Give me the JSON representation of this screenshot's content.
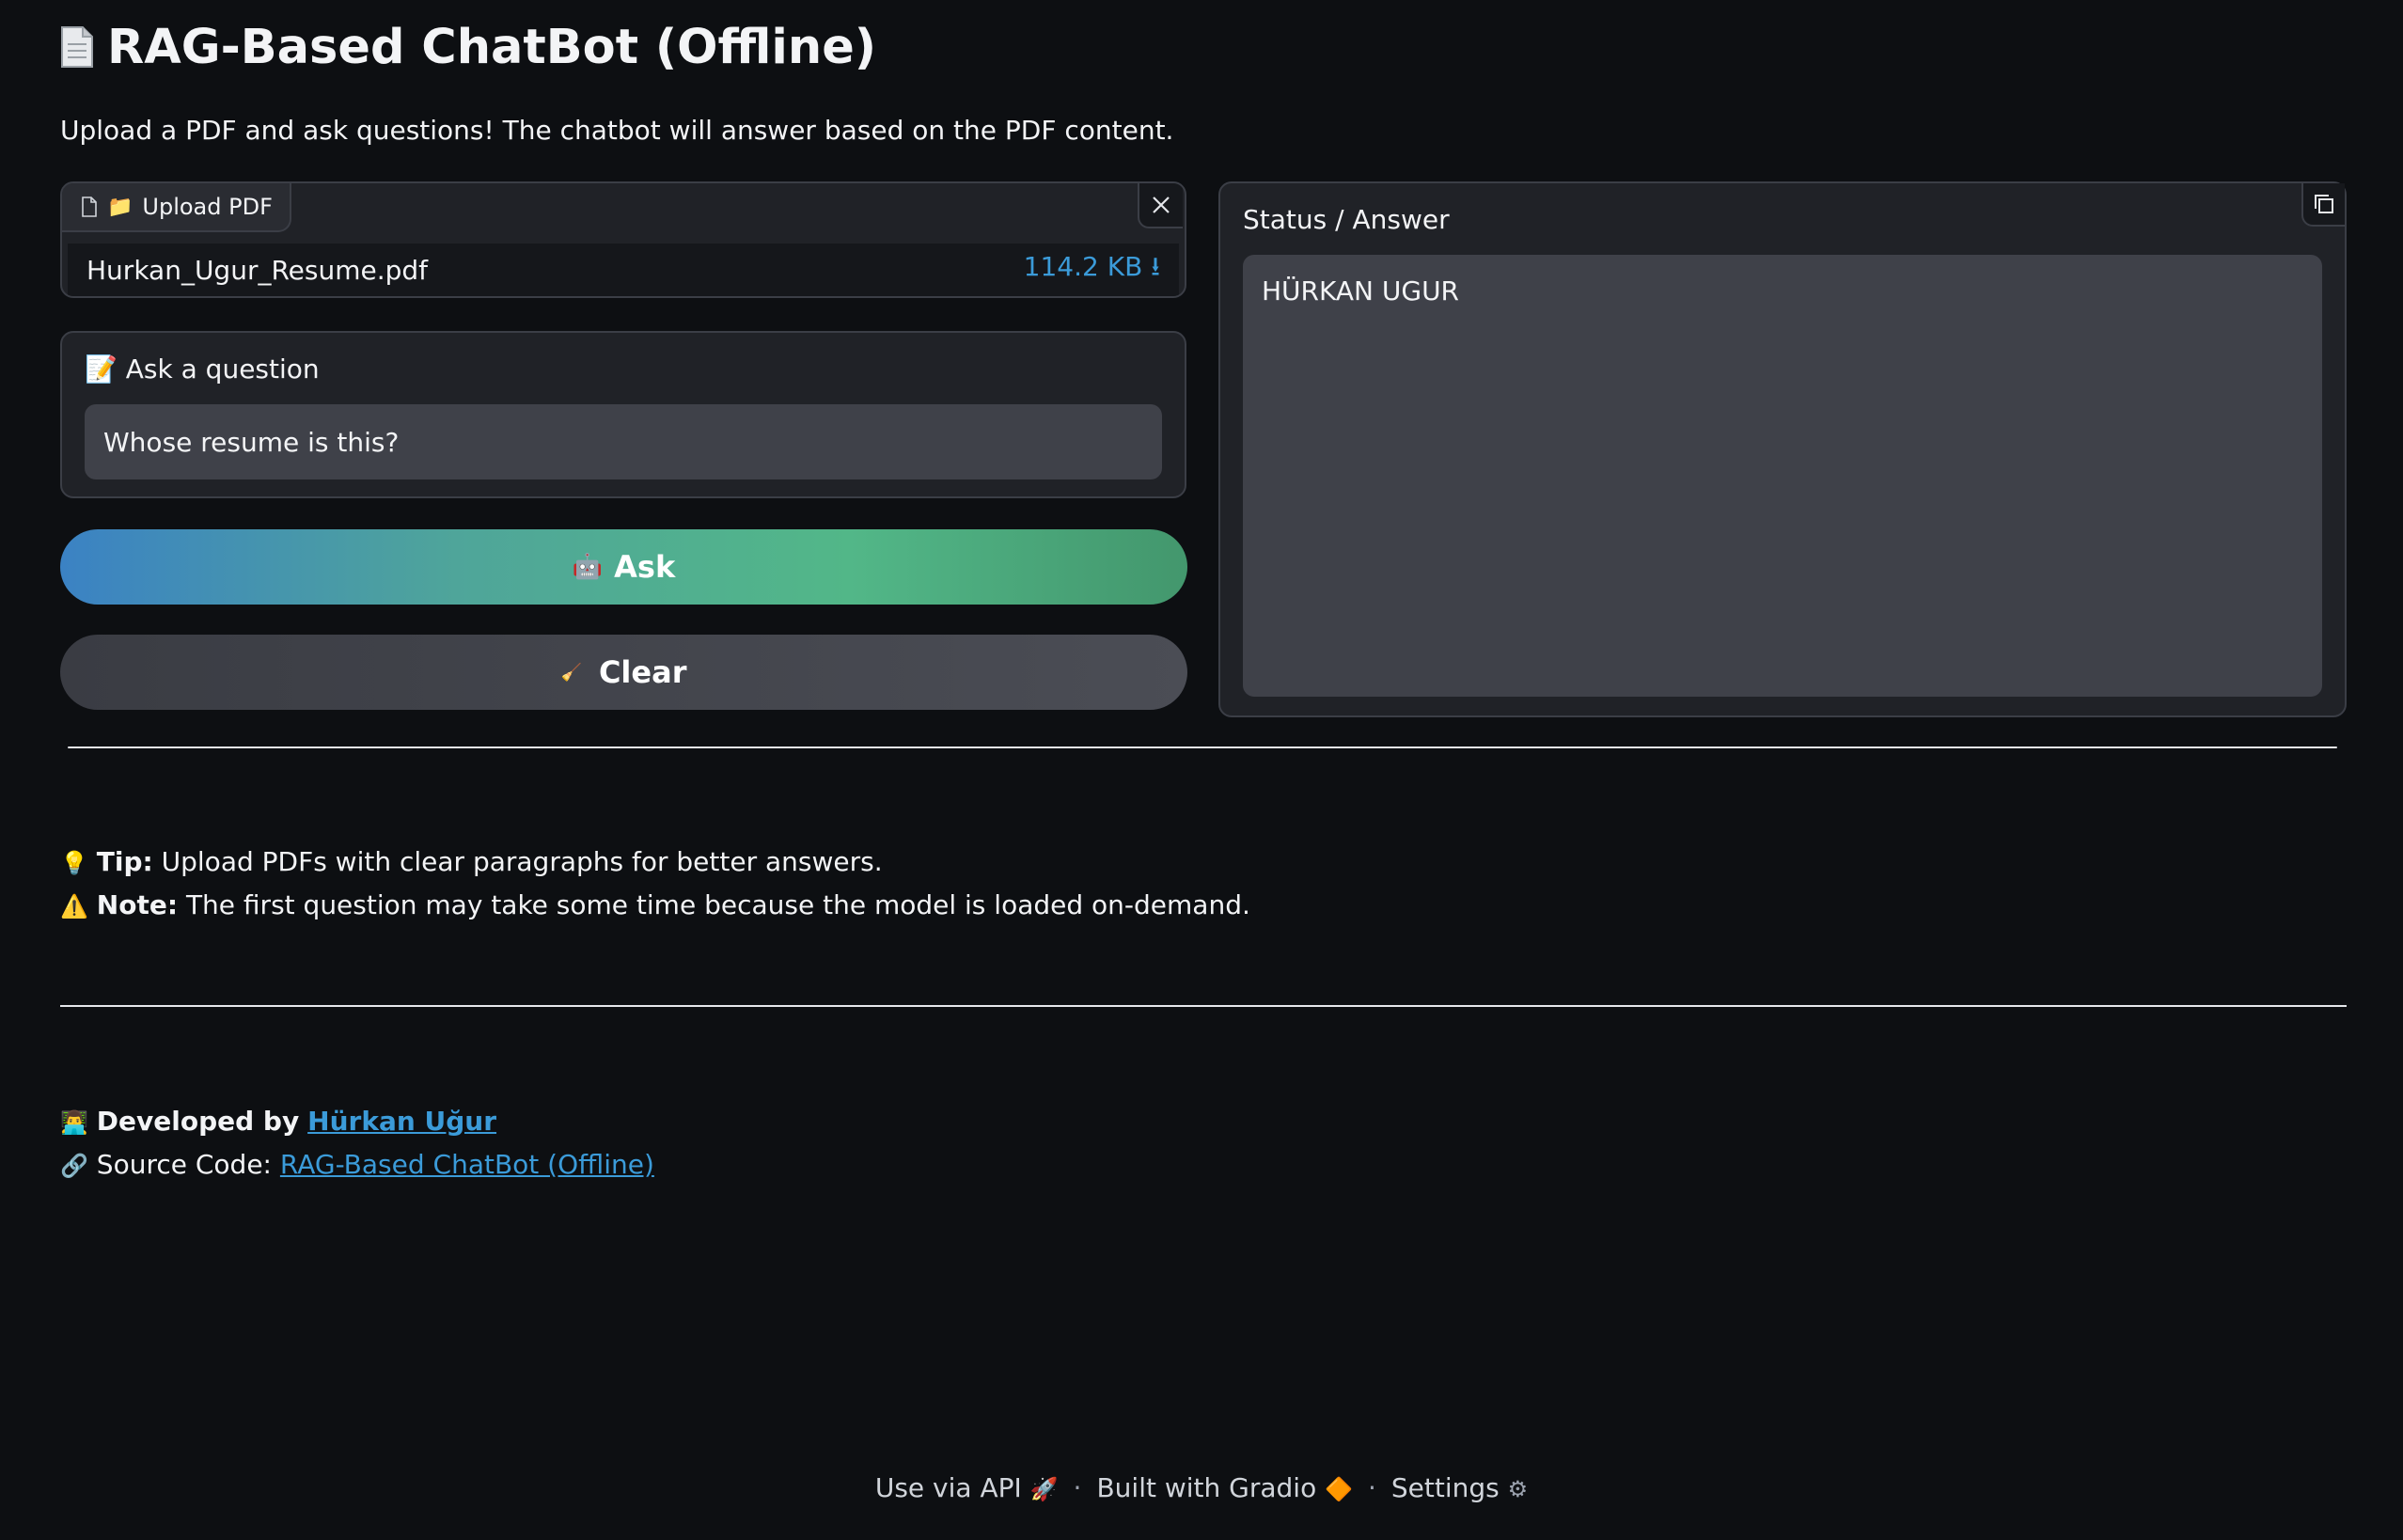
{
  "header": {
    "title": "RAG-Based ChatBot (Offline)",
    "title_icon": "page-facing-up-icon",
    "subtitle": "Upload a PDF and ask questions! The chatbot will answer based on the PDF content."
  },
  "upload": {
    "label": "Upload PDF",
    "label_icons": [
      "file-icon",
      "folder-icon"
    ],
    "file_name": "Hurkan_Ugur_Resume.pdf",
    "file_size": "114.2 KB ⭳"
  },
  "question": {
    "label": "📝 Ask a question",
    "value": "Whose resume is this?"
  },
  "buttons": {
    "ask_emoji": "🤖",
    "ask_label": "Ask",
    "clear_emoji": "🧹",
    "clear_label": "Clear"
  },
  "status": {
    "label": "Status / Answer",
    "answer": "HÜRKAN UGUR"
  },
  "tips": {
    "tip_emoji": "💡",
    "tip_label": "Tip:",
    "tip_text": " Upload PDFs with clear paragraphs for better answers.",
    "note_emoji": "⚠️",
    "note_label": "Note:",
    "note_text": " The first question may take some time because the model is loaded on-demand."
  },
  "credits": {
    "dev_emoji": "👨‍💻",
    "dev_prefix": "Developed by",
    "dev_name": "Hürkan Uğur",
    "src_emoji": "🔗",
    "src_prefix": "Source Code:",
    "src_link": "RAG-Based ChatBot (Offline)"
  },
  "footer": {
    "api": "Use via API",
    "api_emoji": "🚀",
    "sep": "·",
    "built": "Built with Gradio",
    "built_emoji": "🔶",
    "settings": "Settings",
    "settings_emoji": "⚙"
  },
  "colors": {
    "background": "#0d0f12",
    "panel": "#202227",
    "input": "#3f4149",
    "link": "#3b9bd9",
    "ask_gradient": [
      "#3b82c4",
      "#52b788"
    ]
  }
}
